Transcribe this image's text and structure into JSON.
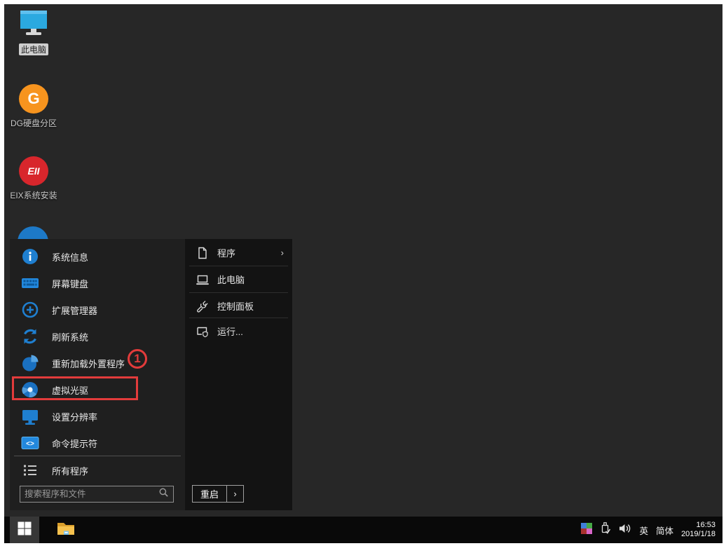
{
  "desktop": {
    "icons": [
      {
        "label": "此电脑"
      },
      {
        "label": "DG硬盘分区",
        "badge": "G"
      },
      {
        "label": "EIX系统安装",
        "badge": "EII"
      }
    ]
  },
  "start_menu": {
    "left_items": [
      {
        "label": "系统信息"
      },
      {
        "label": "屏幕键盘"
      },
      {
        "label": "扩展管理器"
      },
      {
        "label": "刷新系统"
      },
      {
        "label": "重新加载外置程序"
      },
      {
        "label": "虚拟光驱"
      },
      {
        "label": "设置分辨率"
      },
      {
        "label": "命令提示符"
      }
    ],
    "all_programs": "所有程序",
    "search_placeholder": "搜索程序和文件",
    "right_items": [
      {
        "label": "程序",
        "chevron": "›"
      },
      {
        "label": "此电脑"
      },
      {
        "label": "控制面板"
      },
      {
        "label": "运行..."
      }
    ],
    "restart": {
      "label": "重启",
      "chevron": "›"
    }
  },
  "annotation": {
    "number": "1"
  },
  "taskbar": {
    "tray": {
      "lang": "英",
      "ime": "简体",
      "time": "16:53",
      "date": "2019/1/18"
    }
  },
  "colors": {
    "accent_blue": "#1f7fd0",
    "annotation_red": "#e23b3b",
    "desktop_bg": "#272727",
    "menu_left_bg": "#1f1f1f",
    "menu_right_bg": "#131313",
    "taskbar_bg": "#090909"
  }
}
